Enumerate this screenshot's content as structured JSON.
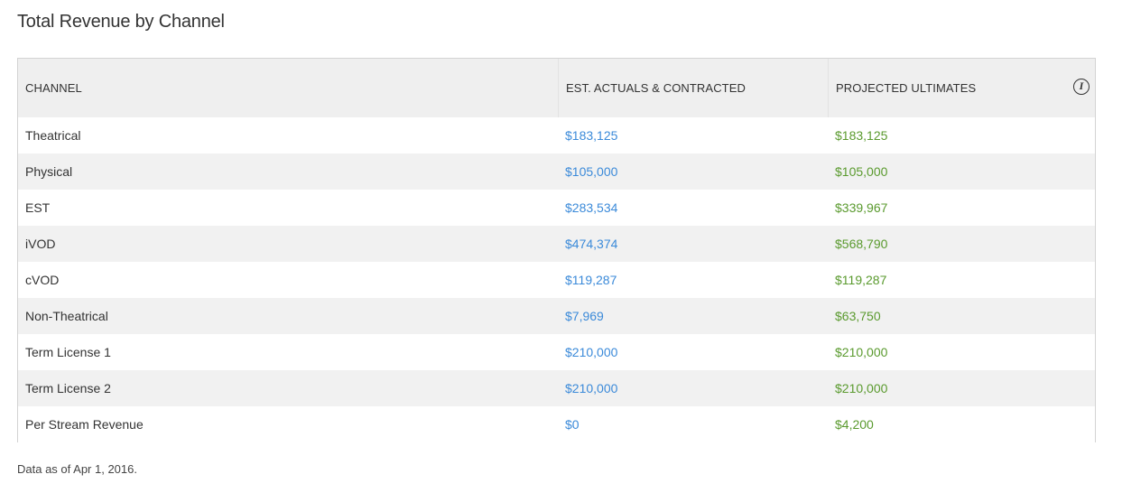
{
  "title": "Total Revenue by Channel",
  "table": {
    "headers": {
      "channel": "CHANNEL",
      "est_actuals": "EST. ACTUALS & CONTRACTED",
      "projected": "PROJECTED ULTIMATES"
    },
    "info_icon": "i",
    "rows": [
      {
        "channel": "Theatrical",
        "est_actuals": "$183,125",
        "projected": "$183,125"
      },
      {
        "channel": "Physical",
        "est_actuals": "$105,000",
        "projected": "$105,000"
      },
      {
        "channel": "EST",
        "est_actuals": "$283,534",
        "projected": "$339,967"
      },
      {
        "channel": "iVOD",
        "est_actuals": "$474,374",
        "projected": "$568,790"
      },
      {
        "channel": "cVOD",
        "est_actuals": "$119,287",
        "projected": "$119,287"
      },
      {
        "channel": "Non-Theatrical",
        "est_actuals": "$7,969",
        "projected": "$63,750"
      },
      {
        "channel": "Term License 1",
        "est_actuals": "$210,000",
        "projected": "$210,000"
      },
      {
        "channel": "Term License 2",
        "est_actuals": "$210,000",
        "projected": "$210,000"
      },
      {
        "channel": "Per Stream Revenue",
        "est_actuals": "$0",
        "projected": "$4,200"
      }
    ]
  },
  "footnote": "Data as of Apr 1, 2016.",
  "colors": {
    "est_actuals_text": "#3b8ad9",
    "projected_text": "#5a9a2e",
    "header_bg": "#efefef",
    "striped_row_bg": "#f1f1f1"
  }
}
